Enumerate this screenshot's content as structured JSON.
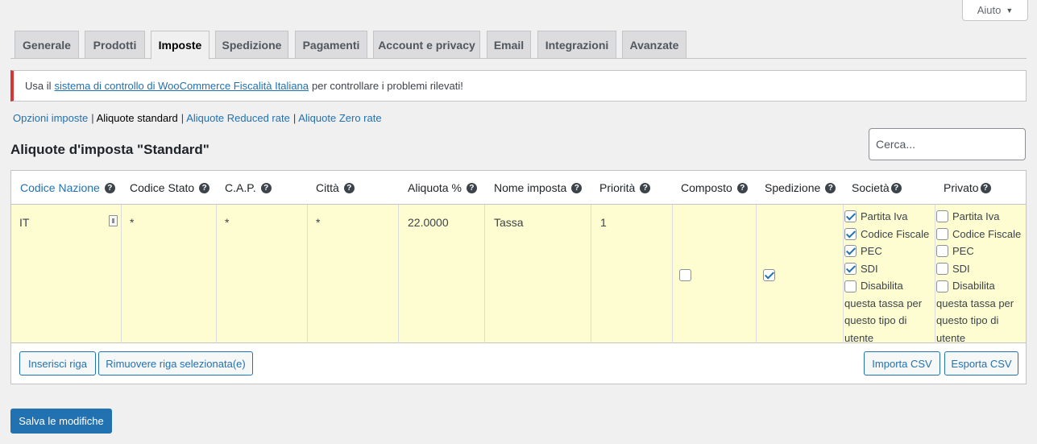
{
  "help": {
    "label": "Aiuto"
  },
  "tabs": [
    {
      "label": "Generale"
    },
    {
      "label": "Prodotti"
    },
    {
      "label": "Imposte"
    },
    {
      "label": "Spedizione"
    },
    {
      "label": "Pagamenti"
    },
    {
      "label": "Account e privacy"
    },
    {
      "label": "Email"
    },
    {
      "label": "Integrazioni"
    },
    {
      "label": "Avanzate"
    }
  ],
  "notice": {
    "prefix": "Usa il",
    "link": "sistema di controllo di WooCommerce Fiscalità Italiana",
    "suffix": "per controllare i problemi rilevati!"
  },
  "subnav": {
    "opzioni": "Opzioni imposte",
    "standard": "Aliquote standard",
    "reduced": "Aliquote Reduced rate",
    "zero": "Aliquote Zero rate"
  },
  "section_title": "Aliquote d'imposta \"Standard\"",
  "search": {
    "placeholder": "Cerca..."
  },
  "columns": {
    "country": "Codice Nazione",
    "state": "Codice Stato",
    "postcode": "C.A.P.",
    "city": "Città",
    "rate": "Aliquota %",
    "name": "Nome imposta",
    "priority": "Priorità",
    "compound": "Composto",
    "shipping": "Spedizione",
    "company": "Società",
    "private": "Privato"
  },
  "row": {
    "country": "IT",
    "state": "*",
    "postcode": "*",
    "city": "*",
    "rate": "22.0000",
    "name": "Tassa",
    "priority": "1",
    "company_opts": {
      "partita_iva": "Partita Iva",
      "codice_fiscale": "Codice Fiscale",
      "pec": "PEC",
      "sdi": "SDI",
      "disable": "Disabilita questa tassa per questo tipo di utente"
    },
    "private_opts": {
      "partita_iva": "Partita Iva",
      "codice_fiscale": "Codice Fiscale",
      "pec": "PEC",
      "sdi": "SDI",
      "disable": "Disabilita questa tassa per questo tipo di utente"
    }
  },
  "buttons": {
    "insert": "Inserisci riga",
    "remove": "Rimuovere riga selezionata(e)",
    "import": "Importa CSV",
    "export": "Esporta CSV",
    "save": "Salva le modifiche"
  },
  "colors": {
    "accent": "#2271b1",
    "row_bg": "#fefdd1",
    "notice_border": "#d63638"
  }
}
